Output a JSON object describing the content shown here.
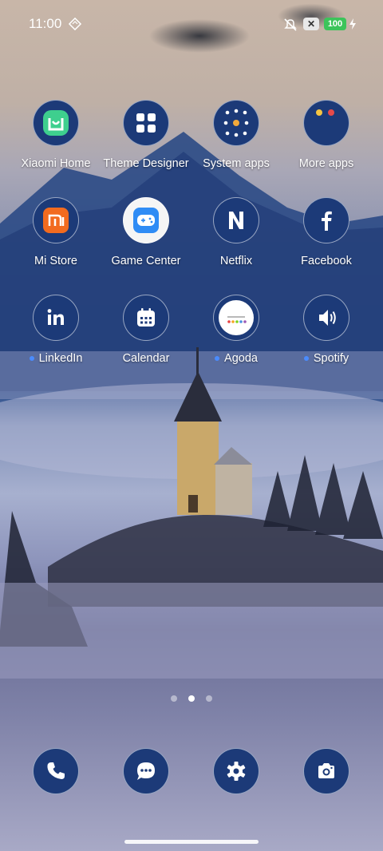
{
  "status_bar": {
    "time": "11:00",
    "battery": "100",
    "battery_color": "#3cc45a",
    "icons": [
      "nfc-icon",
      "mute-icon",
      "sim-x-icon",
      "bolt-icon"
    ]
  },
  "apps": [
    {
      "label": "Xiaomi Home",
      "icon": "xiaomi-home-icon",
      "dot": false
    },
    {
      "label": "Theme Designer",
      "icon": "theme-designer-icon",
      "dot": false
    },
    {
      "label": "System apps",
      "icon": "system-apps-folder-icon",
      "dot": false
    },
    {
      "label": "More apps",
      "icon": "more-apps-folder-icon",
      "dot": false
    },
    {
      "label": "Mi Store",
      "icon": "mi-store-icon",
      "dot": false
    },
    {
      "label": "Game Center",
      "icon": "game-center-icon",
      "dot": false
    },
    {
      "label": "Netflix",
      "icon": "netflix-icon",
      "dot": false
    },
    {
      "label": "Facebook",
      "icon": "facebook-icon",
      "dot": false
    },
    {
      "label": "LinkedIn",
      "icon": "linkedin-icon",
      "dot": true
    },
    {
      "label": "Calendar",
      "icon": "calendar-icon",
      "dot": false
    },
    {
      "label": "Agoda",
      "icon": "agoda-icon",
      "dot": true
    },
    {
      "label": "Spotify",
      "icon": "spotify-icon",
      "dot": true
    }
  ],
  "page_indicator": {
    "pages": 3,
    "active": 2
  },
  "dock": [
    {
      "icon": "phone-icon"
    },
    {
      "icon": "messages-icon"
    },
    {
      "icon": "settings-icon"
    },
    {
      "icon": "camera-icon"
    }
  ]
}
